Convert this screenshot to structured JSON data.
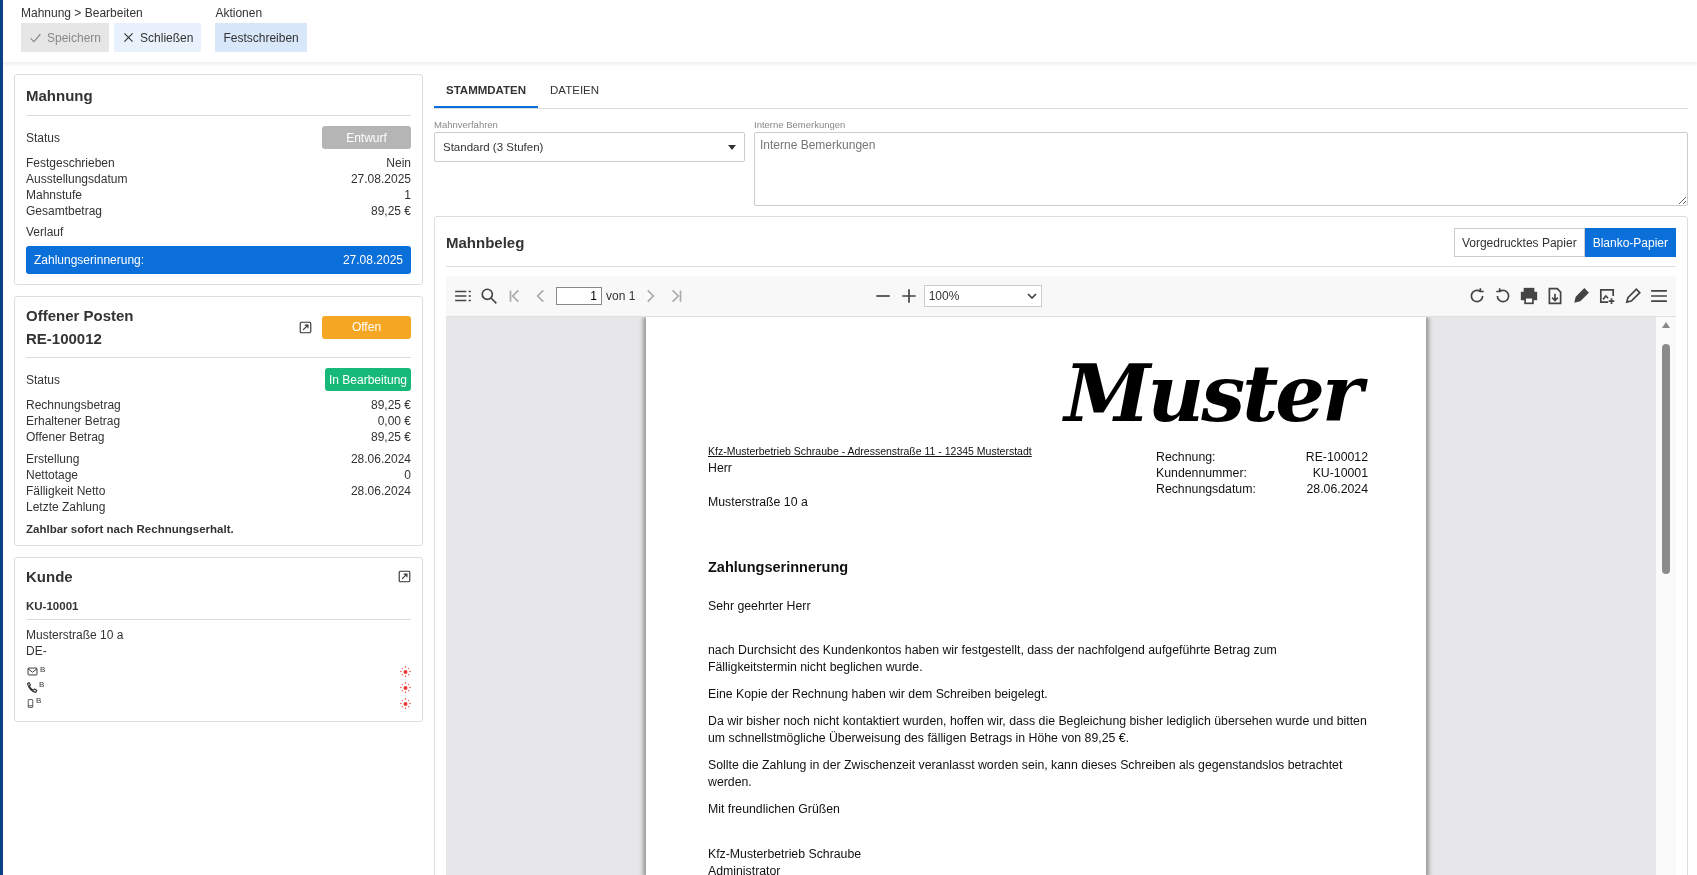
{
  "toolbar": {
    "groups": [
      {
        "label": "Mahnung > Bearbeiten",
        "buttons": [
          {
            "label": "Speichern",
            "kind": "save",
            "disabled": true
          },
          {
            "label": "Schließen",
            "kind": "close",
            "disabled": false
          }
        ]
      },
      {
        "label": "Aktionen",
        "buttons": [
          {
            "label": "Festschreiben",
            "kind": "action",
            "disabled": false
          }
        ]
      }
    ]
  },
  "mahnung": {
    "title": "Mahnung",
    "status": {
      "label": "Status",
      "badge": "Entwurf",
      "kind": "draft"
    },
    "rows": [
      {
        "label": "Festgeschrieben",
        "value": "Nein"
      },
      {
        "label": "Ausstellungsdatum",
        "value": "27.08.2025"
      },
      {
        "label": "Mahnstufe",
        "value": "1"
      },
      {
        "label": "Gesamtbetrag",
        "value": "89,25 €"
      }
    ],
    "history_label": "Verlauf",
    "history": [
      {
        "label": "Zahlungserinnerung:",
        "date": "27.08.2025"
      }
    ]
  },
  "offener_posten": {
    "title": "Offener Posten",
    "number": "RE-100012",
    "badge": {
      "label": "Offen",
      "kind": "open"
    },
    "status": {
      "label": "Status",
      "badge": "In Bearbeitung",
      "kind": "progress"
    },
    "groups": [
      [
        {
          "label": "Rechnungsbetrag",
          "value": "89,25 €"
        },
        {
          "label": "Erhaltener Betrag",
          "value": "0,00 €"
        },
        {
          "label": "Offener Betrag",
          "value": "89,25 €"
        }
      ],
      [
        {
          "label": "Erstellung",
          "value": "28.06.2024"
        },
        {
          "label": "Nettotage",
          "value": "0"
        },
        {
          "label": "Fälligkeit Netto",
          "value": "28.06.2024"
        },
        {
          "label": "Letzte Zahlung"
        }
      ]
    ],
    "note": "Zahlbar sofort nach Rechnungserhalt."
  },
  "kunde": {
    "title": "Kunde",
    "number": "KU-10001",
    "address": [
      "Musterstraße 10 a",
      "DE-"
    ],
    "contacts": [
      {
        "kind": "email",
        "mark": "B"
      },
      {
        "kind": "phone",
        "mark": "B"
      },
      {
        "kind": "mobile",
        "mark": "B"
      }
    ]
  },
  "tabs": [
    {
      "label": "STAMMDATEN",
      "selected": true
    },
    {
      "label": "DATEIEN",
      "selected": false
    }
  ],
  "mahnverfahren": {
    "label": "Mahnverfahren",
    "value": "Standard (3 Stufen)"
  },
  "bemerkungen": {
    "label": "Interne Bemerkungen",
    "placeholder": "Interne Bemerkungen"
  },
  "mahnbeleg": {
    "title": "Mahnbeleg",
    "paper_options": [
      {
        "label": "Vorgedrucktes Papier",
        "selected": false
      },
      {
        "label": "Blanko-Papier",
        "selected": true
      }
    ],
    "viewer": {
      "page": "1",
      "page_count": "von 1",
      "zoom": "100%"
    },
    "document": {
      "logo": "Muster",
      "sender_line": "Kfz-Musterbetrieb Schraube - Adressenstraße 11 - 12345 Musterstadt",
      "recipient": [
        "Herr"
      ],
      "street": "Musterstraße 10 a",
      "info": [
        {
          "label": "Rechnung:",
          "value": "RE-100012"
        },
        {
          "label": "Kundennummer:",
          "value": "KU-10001"
        },
        {
          "label": "Rechnungsdatum:",
          "value": "28.06.2024"
        }
      ],
      "heading": "Zahlungserinnerung",
      "salutation": "Sehr geehrter Herr",
      "paragraphs": [
        "nach Durchsicht des Kundenkontos haben wir festgestellt, dass der nachfolgend aufgeführte Betrag zum Fälligkeitstermin nicht beglichen wurde.",
        "Eine Kopie der Rechnung haben wir dem Schreiben beigelegt.",
        "Da wir bisher noch nicht kontaktiert wurden, hoffen wir, dass die Begleichung bisher lediglich übersehen wurde und bitten um schnellstmögliche Überweisung des fälligen Betrags in Höhe von 89,25 €.",
        "Sollte die Zahlung in der Zwischenzeit veranlasst worden sein, kann dieses Schreiben als gegenstandslos betrachtet werden."
      ],
      "closing": "Mit freundlichen Grüßen",
      "signature": [
        "Kfz-Musterbetrieb Schraube",
        "Administrator"
      ]
    }
  }
}
